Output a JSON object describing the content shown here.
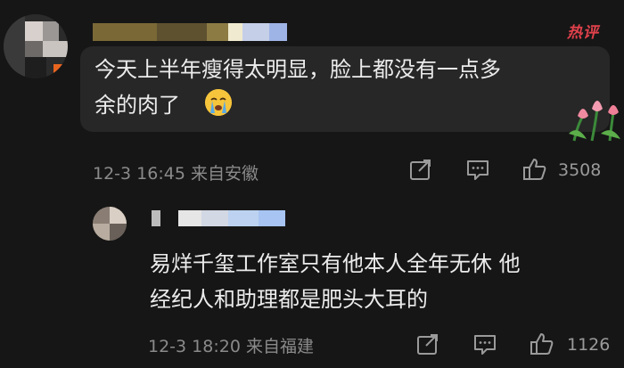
{
  "hot_label": "热评",
  "comments": [
    {
      "text_line1": "今天上半年瘦得太明显，脸上都没有一点多",
      "text_line2": "余的肉了",
      "emoji": "crying-face-emoji",
      "date": "12-3",
      "time": "16:45",
      "location": "来自安徽",
      "likes": "3508"
    },
    {
      "text_line1": "易烊千玺工作室只有他本人全年无休 他",
      "text_line2": "经纪人和助理都是肥头大耳的",
      "date": "12-3",
      "time": "18:20",
      "location": "来自福建",
      "likes": "1126"
    }
  ],
  "icons": {
    "share": "share-icon",
    "comment": "comment-icon",
    "like": "thumbs-up-icon",
    "decoration": "tulips-sticker"
  },
  "colors": {
    "background": "#161616",
    "bubble": "#272727",
    "hot": "#e0414b",
    "meta": "#8a8a8a"
  }
}
